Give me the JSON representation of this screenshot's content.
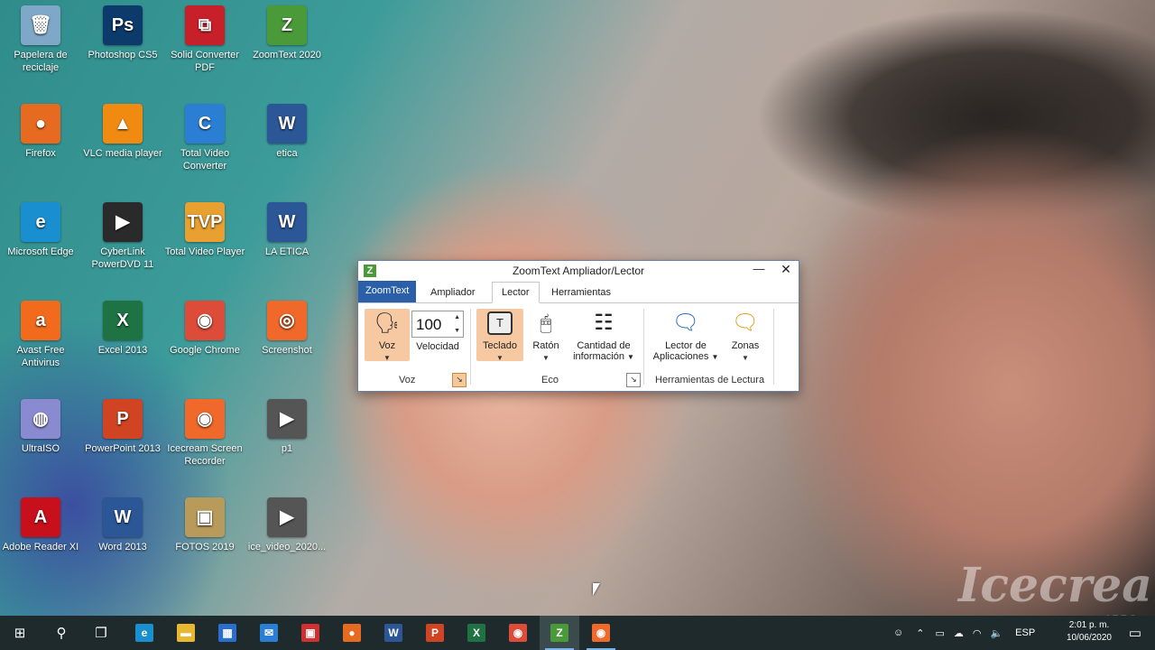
{
  "desktop": {
    "icons": [
      {
        "label": "Papelera de reciclaje",
        "glyph": "🗑",
        "color": "#7fa8c8"
      },
      {
        "label": "Photoshop CS5",
        "glyph": "Ps",
        "color": "#0b3a6b"
      },
      {
        "label": "Solid Converter PDF",
        "glyph": "⧉",
        "color": "#c8202a"
      },
      {
        "label": "ZoomText 2020",
        "glyph": "Z",
        "color": "#4a9a3a"
      },
      {
        "label": "Firefox",
        "glyph": "●",
        "color": "#e66a1f"
      },
      {
        "label": "VLC media player",
        "glyph": "▲",
        "color": "#f08a10"
      },
      {
        "label": "Total Video Converter",
        "glyph": "C",
        "color": "#2a7fd4"
      },
      {
        "label": "etica",
        "glyph": "W",
        "color": "#2b5797"
      },
      {
        "label": "Microsoft Edge",
        "glyph": "e",
        "color": "#1a8fd0"
      },
      {
        "label": "CyberLink PowerDVD 11",
        "glyph": "▶",
        "color": "#2a2a2a"
      },
      {
        "label": "Total Video Player",
        "glyph": "TVP",
        "color": "#e8a030"
      },
      {
        "label": "LA ETICA",
        "glyph": "W",
        "color": "#2b5797"
      },
      {
        "label": "Avast Free Antivirus",
        "glyph": "a",
        "color": "#f26b1d"
      },
      {
        "label": "Excel 2013",
        "glyph": "X",
        "color": "#1f7244"
      },
      {
        "label": "Google Chrome",
        "glyph": "◉",
        "color": "#dd4b39"
      },
      {
        "label": "Screenshot",
        "glyph": "◎",
        "color": "#f0682a"
      },
      {
        "label": "UltraISO",
        "glyph": "◍",
        "color": "#8a8ad0"
      },
      {
        "label": "PowerPoint 2013",
        "glyph": "P",
        "color": "#d04423"
      },
      {
        "label": "Icecream Screen Recorder",
        "glyph": "◉",
        "color": "#f0682a"
      },
      {
        "label": "p1",
        "glyph": "▶",
        "color": "#555555"
      },
      {
        "label": "Adobe Reader XI",
        "glyph": "A",
        "color": "#c8101c"
      },
      {
        "label": "Word 2013",
        "glyph": "W",
        "color": "#2b5797"
      },
      {
        "label": "FOTOS 2019",
        "glyph": "▣",
        "color": "#b89a5a"
      },
      {
        "label": "ice_video_2020...",
        "glyph": "▶",
        "color": "#555555"
      }
    ]
  },
  "window": {
    "title": "ZoomText Ampliador/Lector",
    "logo": "Z",
    "minimize": "—",
    "close": "✕",
    "tabs": [
      "ZoomText",
      "Ampliador",
      "Lector",
      "Herramientas"
    ],
    "active_tab": "Lector",
    "ribbon": {
      "voz": {
        "label": "Voz",
        "glyph": "🗣"
      },
      "velocidad": {
        "value": "100",
        "label": "Velocidad"
      },
      "group_voz": "Voz",
      "teclado": {
        "label": "Teclado",
        "glyph": "T"
      },
      "raton": {
        "label": "Ratón",
        "glyph": "🖱"
      },
      "cantidad": {
        "label_1": "Cantidad de",
        "label_2": "información",
        "glyph": "☷"
      },
      "group_eco": "Eco",
      "lector_apps": {
        "label_1": "Lector de",
        "label_2": "Aplicaciones",
        "glyph": "🗨"
      },
      "zonas": {
        "label": "Zonas",
        "glyph": "🗨"
      },
      "group_herr": "Herramientas de Lectura"
    }
  },
  "taskbar": {
    "start": "⊞",
    "search": "⚲",
    "taskview": "❐",
    "items": [
      {
        "name": "edge",
        "glyph": "e",
        "color": "#1a8fd0"
      },
      {
        "name": "explorer",
        "glyph": "▬",
        "color": "#e8b830"
      },
      {
        "name": "store",
        "glyph": "▦",
        "color": "#2a6fd0"
      },
      {
        "name": "mail",
        "glyph": "✉",
        "color": "#2a7fd4"
      },
      {
        "name": "gift",
        "glyph": "▣",
        "color": "#d03030"
      },
      {
        "name": "firefox",
        "glyph": "●",
        "color": "#e66a1f"
      },
      {
        "name": "word",
        "glyph": "W",
        "color": "#2b5797"
      },
      {
        "name": "powerpoint",
        "glyph": "P",
        "color": "#d04423"
      },
      {
        "name": "excel",
        "glyph": "X",
        "color": "#1f7244"
      },
      {
        "name": "chrome",
        "glyph": "◉",
        "color": "#dd4b39"
      },
      {
        "name": "zoomtext",
        "glyph": "Z",
        "color": "#4a9a3a"
      },
      {
        "name": "icecream",
        "glyph": "◉",
        "color": "#f0682a"
      }
    ],
    "tray_lang": "ESP",
    "time": "2:01 p. m.",
    "date": "10/06/2020"
  },
  "watermark": {
    "main": "Icecream",
    "sub": "APPS"
  }
}
